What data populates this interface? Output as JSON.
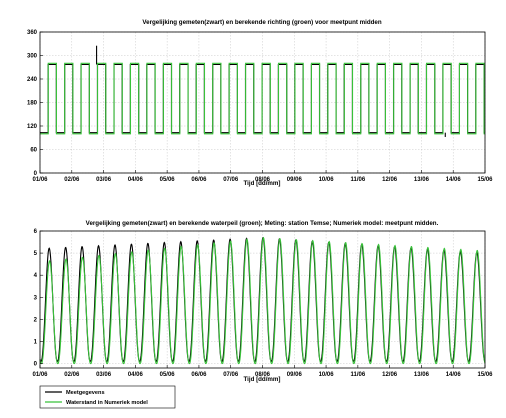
{
  "colors": {
    "measured": "#000000",
    "model": "#39c23a",
    "grid": "#c8c8c8",
    "axis": "#000000"
  },
  "x_tick_labels": [
    "01/06",
    "02/06",
    "03/06",
    "04/06",
    "05/06",
    "06/06",
    "07/06",
    "08/06",
    "09/06",
    "10/06",
    "11/06",
    "12/06",
    "13/06",
    "14/06",
    "15/06"
  ],
  "legend": {
    "placement": "bottom-left",
    "entries": [
      {
        "label": "Meetgegevens",
        "color": "#000000"
      },
      {
        "label": "Waterstand in Numeriek model",
        "color": "#39c23a"
      }
    ]
  },
  "chart_data": [
    {
      "type": "line",
      "title": "Vergelijking gemeten(zwart) en berekende richting (groen) voor meetpunt midden",
      "xlabel": "Tijd [dd/mm]",
      "ylabel": "",
      "xlim": [
        1,
        15
      ],
      "ylim": [
        0,
        360
      ],
      "yticks": [
        0,
        60,
        120,
        180,
        240,
        300,
        360
      ],
      "grid": true,
      "tidal_period_days": 0.5175,
      "series": [
        {
          "color": "#000000",
          "shape": "square-wave",
          "low": 103,
          "high": 277,
          "spikes": [
            {
              "x": 2.78,
              "y": 325
            },
            {
              "x": 13.75,
              "y": 92
            }
          ]
        },
        {
          "color": "#39c23a",
          "shape": "square-wave",
          "low": 100,
          "high": 280
        }
      ]
    },
    {
      "type": "line",
      "title": "Vergelijking gemeten(zwart) en berekende waterpeil (groen); Meting: station Temse; Numeriek model: meetpunt midden.",
      "xlabel": "Tijd [dd/mm]",
      "ylabel": "",
      "xlim": [
        1,
        15
      ],
      "ylim": [
        -0.2,
        6
      ],
      "yticks": [
        0,
        1,
        2,
        3,
        4,
        5,
        6
      ],
      "grid": true,
      "tidal_period_days": 0.5175,
      "series": [
        {
          "color": "#000000",
          "shape": "tide",
          "low": 0.1,
          "high_start": 5.2,
          "high_mid": 5.7,
          "high_end": 5.0
        },
        {
          "color": "#39c23a",
          "shape": "tide",
          "low": 0.0,
          "high_start": 4.6,
          "high_mid": 5.7,
          "high_end": 5.1
        }
      ]
    }
  ]
}
